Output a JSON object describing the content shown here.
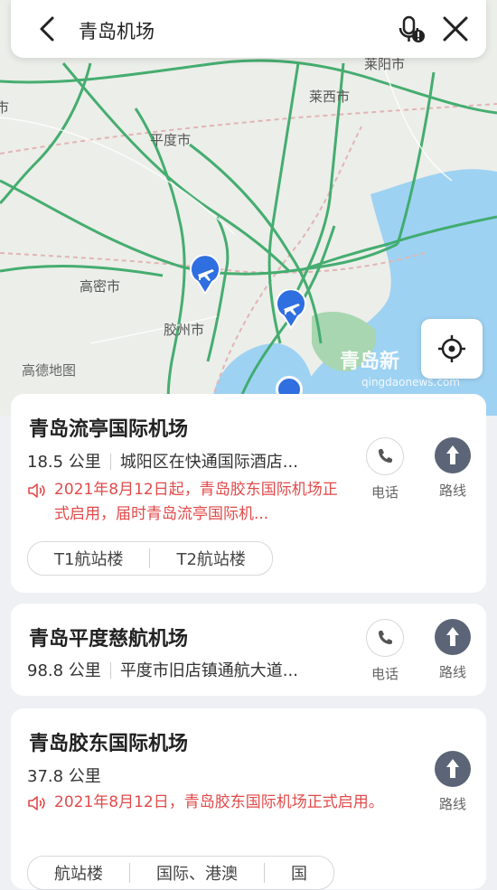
{
  "search": {
    "query": "青岛机场"
  },
  "map": {
    "cities": [
      "莱阳市",
      "莱西市",
      "平度市",
      "高密市",
      "胶州市",
      "邑市"
    ],
    "attribution": "高德地图",
    "watermark_logo": "青岛新",
    "watermark_url": "qingdaonews.com"
  },
  "results": [
    {
      "name": "青岛流亭国际机场",
      "distance": "18.5 公里",
      "address": "城阳区在快通国际酒店...",
      "notice": "2021年8月12日起，青岛胶东国际机场正式启用，届时青岛流亭国际机...",
      "phone_label": "电话",
      "route_label": "路线",
      "tags": [
        "T1航站楼",
        "T2航站楼"
      ]
    },
    {
      "name": "青岛平度慈航机场",
      "distance": "98.8 公里",
      "address": "平度市旧店镇通航大道...",
      "phone_label": "电话",
      "route_label": "路线"
    },
    {
      "name": "青岛胶东国际机场",
      "distance": "37.8 公里",
      "notice": "2021年8月12日，青岛胶东国际机场正式启用。",
      "route_label": "路线",
      "tags": [
        "航站楼",
        "国际、港澳",
        "国"
      ]
    }
  ],
  "colors": {
    "road": "#3daa6a",
    "water": "#9ed2f2",
    "notice": "#e24a4a",
    "route_button": "#5b6577",
    "pin": "#2f6fe0"
  }
}
